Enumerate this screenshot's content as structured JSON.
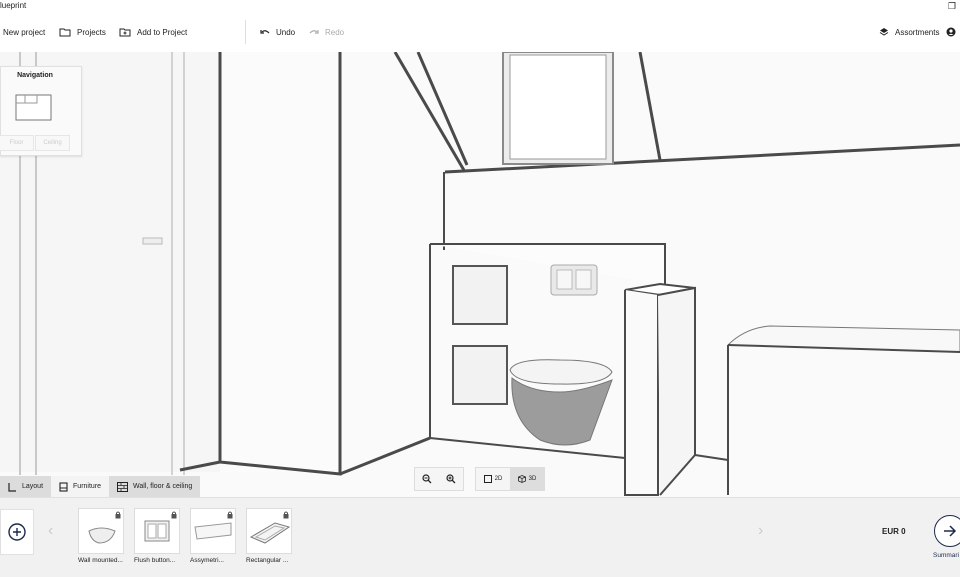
{
  "window": {
    "title": "lueprint",
    "restore_glyph": "❐"
  },
  "toolbar": {
    "new_project": "New project",
    "projects": "Projects",
    "add_to_project": "Add to Project",
    "undo": "Undo",
    "redo": "Redo",
    "assortments": "Assortments"
  },
  "navigation": {
    "title": "Navigation",
    "floor": "Floor",
    "ceiling": "Ceiling"
  },
  "view_controls": {
    "zoom_out_icon": "zoom-out-icon",
    "zoom_in_icon": "zoom-in-icon",
    "mode_2d": "2D",
    "mode_3d": "3D",
    "active_mode": "3D"
  },
  "tabs": [
    {
      "label": "Layout",
      "icon": "layout-icon",
      "active": false
    },
    {
      "label": "Furniture",
      "icon": "furniture-icon",
      "active": true
    },
    {
      "label": "Wall, floor & ceiling",
      "icon": "brick-wall-icon",
      "active": false
    }
  ],
  "catalog": {
    "items": [
      {
        "label": "Wall mounted..."
      },
      {
        "label": "Flush button..."
      },
      {
        "label": "Assymetri..."
      },
      {
        "label": "Rectangular ..."
      }
    ],
    "prev_arrow": "‹",
    "next_arrow": "›"
  },
  "footer": {
    "price": "EUR  0",
    "summary": "Summari"
  },
  "colors": {
    "accent": "#1d2a4a",
    "wall_edge": "#4a4a4a"
  }
}
